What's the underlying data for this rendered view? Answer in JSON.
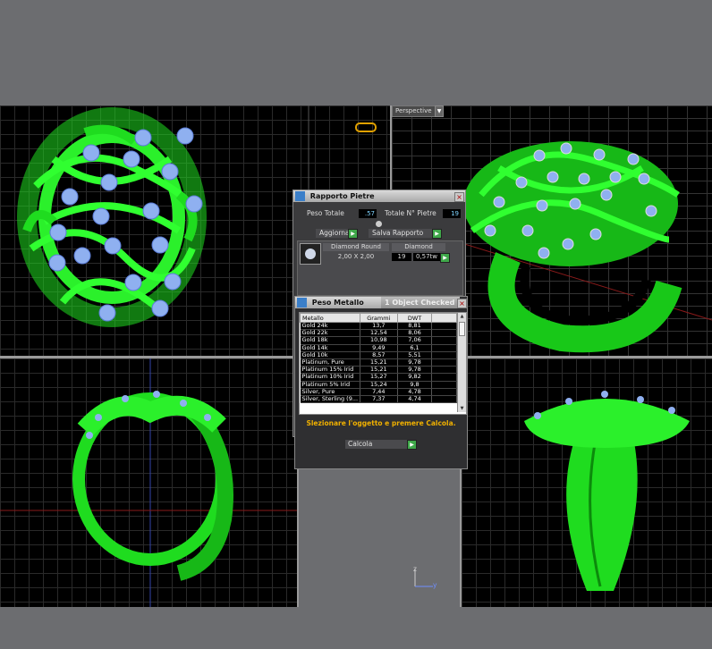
{
  "viewport": {
    "top_right_label": "Perspective",
    "axis_z": "z",
    "axis_y": "y"
  },
  "rapporto_pietre": {
    "title": "Rapporto Pietre",
    "peso_totale_label": "Peso Totale",
    "peso_totale_value": ".57",
    "totale_pietre_label": "Totale N° Pietre",
    "totale_pietre_value": "19",
    "aggiorna_label": "Aggiorna",
    "salva_label": "Salva Rapporto",
    "stone_shape": "Diamond Round",
    "stone_type": "Diamond",
    "stone_size": "2,00 X 2,00",
    "stone_count": "19",
    "stone_weight": "0,57tw"
  },
  "peso_metallo": {
    "title": "Peso Metallo",
    "subtitle": "1 Object Checked",
    "columns": [
      "Metallo",
      "Grammi",
      "DWT"
    ],
    "rows": [
      [
        "Gold 24k",
        "13,7",
        "8,81"
      ],
      [
        "Gold 22k",
        "12,54",
        "8,06"
      ],
      [
        "Gold 18k",
        "10,98",
        "7,06"
      ],
      [
        "Gold 14k",
        "9,49",
        "6,1"
      ],
      [
        "Gold 10k",
        "8,57",
        "5,51"
      ],
      [
        "Platinum, Pure",
        "15,21",
        "9,78"
      ],
      [
        "Platinum 15% Irid",
        "15,21",
        "9,78"
      ],
      [
        "Platinum 10% Irid",
        "15,27",
        "9,82"
      ],
      [
        "Platinum 5% Irid",
        "15,24",
        "9,8"
      ],
      [
        "Silver, Pure",
        "7,44",
        "4,78"
      ],
      [
        "Silver, Sterling (9...",
        "7,37",
        "4,74"
      ]
    ],
    "status_text": "Slezionare l'oggetto e premere Calcola.",
    "calcola_label": "Calcola"
  },
  "colors": {
    "model_green": "#1fdc1f",
    "gem_blue": "#8fb0f0",
    "viewport_bg": "#000000",
    "status_text": "#f0b000"
  }
}
